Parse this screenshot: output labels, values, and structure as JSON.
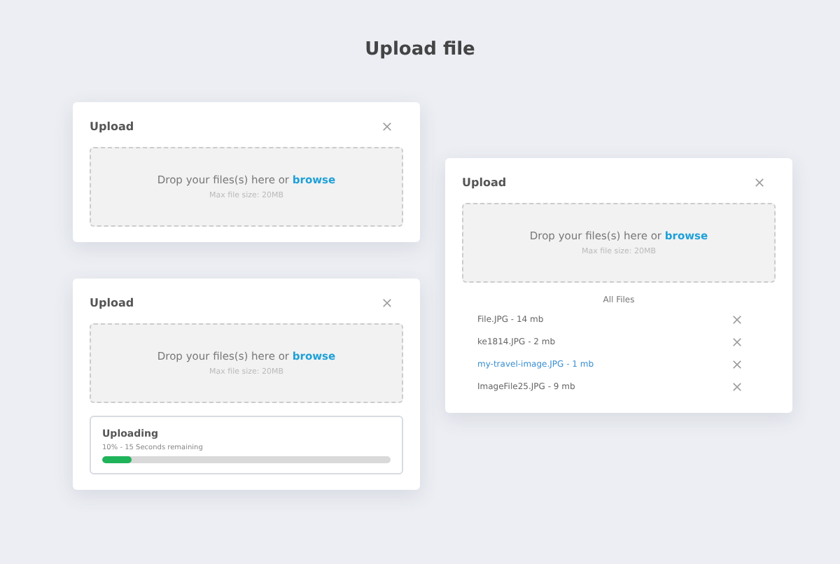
{
  "page_title": "Upload file",
  "cards": [
    {
      "kind": "basic",
      "title": "Upload",
      "drop_prompt": "Drop your files(s) here or",
      "drop_link": "browse",
      "max_size": "Max file size: 20MB"
    },
    {
      "kind": "progress",
      "title": "Upload",
      "drop_prompt": "Drop your files(s) here or",
      "drop_link": "browse",
      "max_size": "Max file size: 20MB",
      "progress": {
        "title": "Uploading",
        "status": "10% - 15 Seconds remaining",
        "level": 0.1
      }
    },
    {
      "kind": "files",
      "title": "Upload",
      "drop_prompt": "Drop your files(s) here or",
      "drop_link": "browse",
      "max_size": "Max file size: 20MB",
      "files_heading": "All Files",
      "files": [
        {
          "name": "File.JPG - 14 mb",
          "selected": false
        },
        {
          "name": "ke1814.JPG - 2 mb",
          "selected": false
        },
        {
          "name": "my-travel-image.JPG - 1 mb",
          "selected": true
        },
        {
          "name": "ImageFile25.JPG - 9 mb",
          "selected": false
        }
      ]
    }
  ]
}
